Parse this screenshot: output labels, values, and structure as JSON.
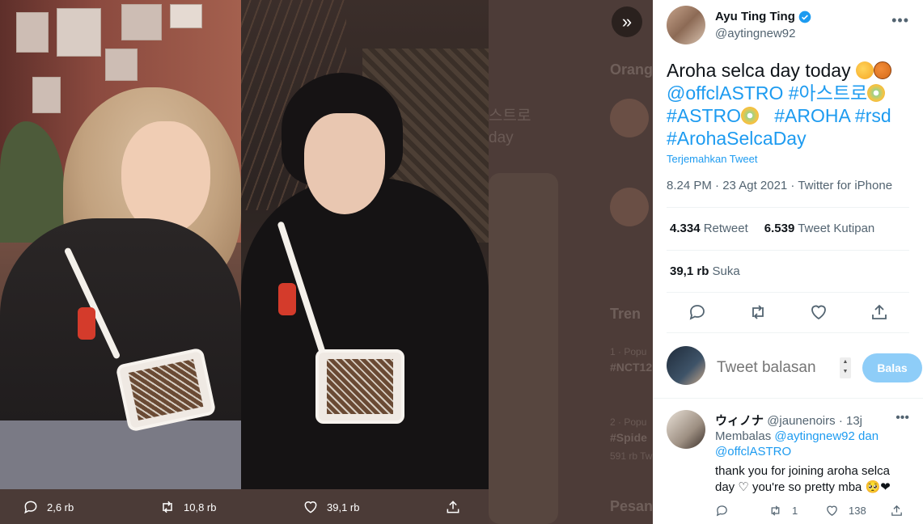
{
  "media": {
    "actions": {
      "reply_count": "2,6 rb",
      "retweet_count": "10,8 rb",
      "like_count": "39,1 rb"
    }
  },
  "tweet": {
    "author_name": "Ayu Ting Ting",
    "author_handle": "@aytingnew92",
    "text_line1": "Aroha selca day today",
    "mention": "@offclASTRO",
    "hashtag1": "#아스트로",
    "hashtag2": "#ASTRO",
    "hashtag3": "#AROHA",
    "hashtag4": "#rsd",
    "hashtag5": "#ArohaSelcaDay",
    "translate_label": "Terjemahkan Tweet",
    "meta": "8.24 PM · 23 Agt 2021 · Twitter for iPhone",
    "retweets_value": "4.334",
    "retweets_label": "Retweet",
    "quotes_value": "6.539",
    "quotes_label": "Tweet Kutipan",
    "likes_value": "39,1 rb",
    "likes_label": "Suka"
  },
  "reply_composer": {
    "placeholder": "Tweet balasan",
    "button_label": "Balas"
  },
  "reply": {
    "author_name": "ウィノナ",
    "author_handle": "@jaunenoirs",
    "time": "· 13j",
    "replying_prefix": "Membalas",
    "replying_user1": "@aytingnew92",
    "replying_and": "dan",
    "replying_user2": "@offclASTRO",
    "text": "thank you for joining aroha selca day ♡ you're so pretty mba 🥺❤",
    "retweet_count": "1",
    "like_count": "138"
  },
  "background": {
    "heading1": "Orang",
    "heading2": "Tren",
    "heading3": "Pesan",
    "trend1_meta": "1 · Popu",
    "trend1_tag": "#NCT12",
    "trend2_meta": "2 · Popu",
    "trend2_tag": "#Spide",
    "trend2_count": "591 rb Tw",
    "korean_text": "스트로",
    "day_text": "day"
  },
  "colors": {
    "accent": "#1d9bf0",
    "reply_button": "#8ecdf8",
    "text_primary": "#0f1419",
    "text_secondary": "#536471"
  }
}
